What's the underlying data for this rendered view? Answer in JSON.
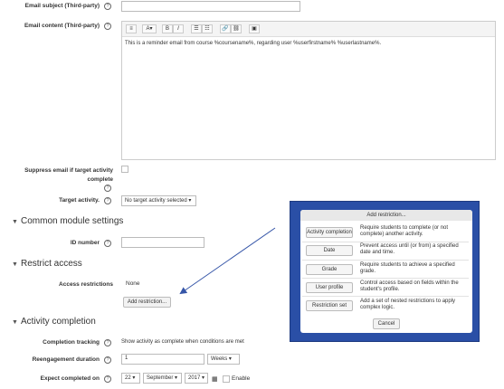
{
  "fields": {
    "email_subject_label": "Email subject (Third-party)",
    "email_content_label": "Email content (Third-party)",
    "email_content_text": "This is a reminder email from course %coursename%, regarding user %userfirstname% %userlastname%.",
    "suppress_label_line1": "Suppress email if target activity",
    "suppress_label_line2": "complete",
    "target_activity_label": "Target activity.",
    "target_activity_value": "No target activity selected",
    "id_number_label": "ID number",
    "access_restrictions_label": "Access restrictions",
    "access_restrictions_value": "None",
    "add_restriction_button": "Add restriction...",
    "completion_tracking_label": "Completion tracking",
    "completion_tracking_value": "Show activity as complete when conditions are met",
    "reengagement_label": "Reengagement duration",
    "reengagement_value": "1",
    "reengagement_unit": "Weeks",
    "expect_label": "Expect completed on",
    "expect_day": "22",
    "expect_month": "September",
    "expect_year": "2017",
    "enable_label": "Enable"
  },
  "sections": {
    "common": "Common module settings",
    "restrict": "Restrict access",
    "completion": "Activity completion"
  },
  "help_glyph": "?",
  "toolbar_glyphs": [
    "≡",
    "A▾",
    "B",
    "I",
    "☰",
    "☷",
    "🔗",
    "⛓",
    "▣"
  ],
  "dialog": {
    "title": "Add restriction...",
    "items": [
      {
        "button": "Activity completion",
        "desc": "Require students to complete (or not complete) another activity."
      },
      {
        "button": "Date",
        "desc": "Prevent access until (or from) a specified date and time."
      },
      {
        "button": "Grade",
        "desc": "Require students to achieve a specified grade."
      },
      {
        "button": "User profile",
        "desc": "Control access based on fields within the student's profile."
      },
      {
        "button": "Restriction set",
        "desc": "Add a set of nested restrictions to apply complex logic."
      }
    ],
    "cancel": "Cancel"
  },
  "colors": {
    "dialog_frame": "#2a4fa6",
    "arrow": "#3656a8"
  }
}
